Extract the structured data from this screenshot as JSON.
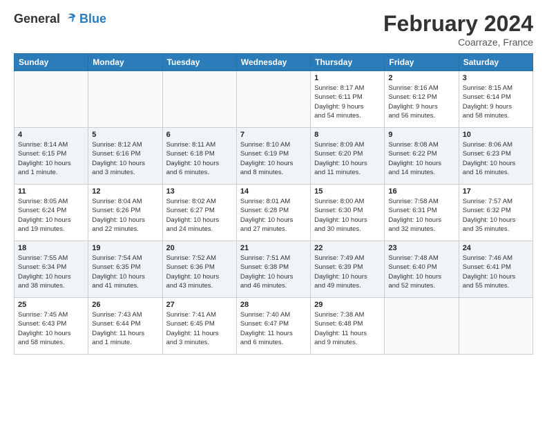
{
  "header": {
    "logo_general": "General",
    "logo_blue": "Blue",
    "title": "February 2024",
    "location": "Coarraze, France"
  },
  "days_of_week": [
    "Sunday",
    "Monday",
    "Tuesday",
    "Wednesday",
    "Thursday",
    "Friday",
    "Saturday"
  ],
  "weeks": [
    [
      {
        "day": "",
        "info": ""
      },
      {
        "day": "",
        "info": ""
      },
      {
        "day": "",
        "info": ""
      },
      {
        "day": "",
        "info": ""
      },
      {
        "day": "1",
        "info": "Sunrise: 8:17 AM\nSunset: 6:11 PM\nDaylight: 9 hours\nand 54 minutes."
      },
      {
        "day": "2",
        "info": "Sunrise: 8:16 AM\nSunset: 6:12 PM\nDaylight: 9 hours\nand 56 minutes."
      },
      {
        "day": "3",
        "info": "Sunrise: 8:15 AM\nSunset: 6:14 PM\nDaylight: 9 hours\nand 58 minutes."
      }
    ],
    [
      {
        "day": "4",
        "info": "Sunrise: 8:14 AM\nSunset: 6:15 PM\nDaylight: 10 hours\nand 1 minute."
      },
      {
        "day": "5",
        "info": "Sunrise: 8:12 AM\nSunset: 6:16 PM\nDaylight: 10 hours\nand 3 minutes."
      },
      {
        "day": "6",
        "info": "Sunrise: 8:11 AM\nSunset: 6:18 PM\nDaylight: 10 hours\nand 6 minutes."
      },
      {
        "day": "7",
        "info": "Sunrise: 8:10 AM\nSunset: 6:19 PM\nDaylight: 10 hours\nand 8 minutes."
      },
      {
        "day": "8",
        "info": "Sunrise: 8:09 AM\nSunset: 6:20 PM\nDaylight: 10 hours\nand 11 minutes."
      },
      {
        "day": "9",
        "info": "Sunrise: 8:08 AM\nSunset: 6:22 PM\nDaylight: 10 hours\nand 14 minutes."
      },
      {
        "day": "10",
        "info": "Sunrise: 8:06 AM\nSunset: 6:23 PM\nDaylight: 10 hours\nand 16 minutes."
      }
    ],
    [
      {
        "day": "11",
        "info": "Sunrise: 8:05 AM\nSunset: 6:24 PM\nDaylight: 10 hours\nand 19 minutes."
      },
      {
        "day": "12",
        "info": "Sunrise: 8:04 AM\nSunset: 6:26 PM\nDaylight: 10 hours\nand 22 minutes."
      },
      {
        "day": "13",
        "info": "Sunrise: 8:02 AM\nSunset: 6:27 PM\nDaylight: 10 hours\nand 24 minutes."
      },
      {
        "day": "14",
        "info": "Sunrise: 8:01 AM\nSunset: 6:28 PM\nDaylight: 10 hours\nand 27 minutes."
      },
      {
        "day": "15",
        "info": "Sunrise: 8:00 AM\nSunset: 6:30 PM\nDaylight: 10 hours\nand 30 minutes."
      },
      {
        "day": "16",
        "info": "Sunrise: 7:58 AM\nSunset: 6:31 PM\nDaylight: 10 hours\nand 32 minutes."
      },
      {
        "day": "17",
        "info": "Sunrise: 7:57 AM\nSunset: 6:32 PM\nDaylight: 10 hours\nand 35 minutes."
      }
    ],
    [
      {
        "day": "18",
        "info": "Sunrise: 7:55 AM\nSunset: 6:34 PM\nDaylight: 10 hours\nand 38 minutes."
      },
      {
        "day": "19",
        "info": "Sunrise: 7:54 AM\nSunset: 6:35 PM\nDaylight: 10 hours\nand 41 minutes."
      },
      {
        "day": "20",
        "info": "Sunrise: 7:52 AM\nSunset: 6:36 PM\nDaylight: 10 hours\nand 43 minutes."
      },
      {
        "day": "21",
        "info": "Sunrise: 7:51 AM\nSunset: 6:38 PM\nDaylight: 10 hours\nand 46 minutes."
      },
      {
        "day": "22",
        "info": "Sunrise: 7:49 AM\nSunset: 6:39 PM\nDaylight: 10 hours\nand 49 minutes."
      },
      {
        "day": "23",
        "info": "Sunrise: 7:48 AM\nSunset: 6:40 PM\nDaylight: 10 hours\nand 52 minutes."
      },
      {
        "day": "24",
        "info": "Sunrise: 7:46 AM\nSunset: 6:41 PM\nDaylight: 10 hours\nand 55 minutes."
      }
    ],
    [
      {
        "day": "25",
        "info": "Sunrise: 7:45 AM\nSunset: 6:43 PM\nDaylight: 10 hours\nand 58 minutes."
      },
      {
        "day": "26",
        "info": "Sunrise: 7:43 AM\nSunset: 6:44 PM\nDaylight: 11 hours\nand 1 minute."
      },
      {
        "day": "27",
        "info": "Sunrise: 7:41 AM\nSunset: 6:45 PM\nDaylight: 11 hours\nand 3 minutes."
      },
      {
        "day": "28",
        "info": "Sunrise: 7:40 AM\nSunset: 6:47 PM\nDaylight: 11 hours\nand 6 minutes."
      },
      {
        "day": "29",
        "info": "Sunrise: 7:38 AM\nSunset: 6:48 PM\nDaylight: 11 hours\nand 9 minutes."
      },
      {
        "day": "",
        "info": ""
      },
      {
        "day": "",
        "info": ""
      }
    ]
  ]
}
